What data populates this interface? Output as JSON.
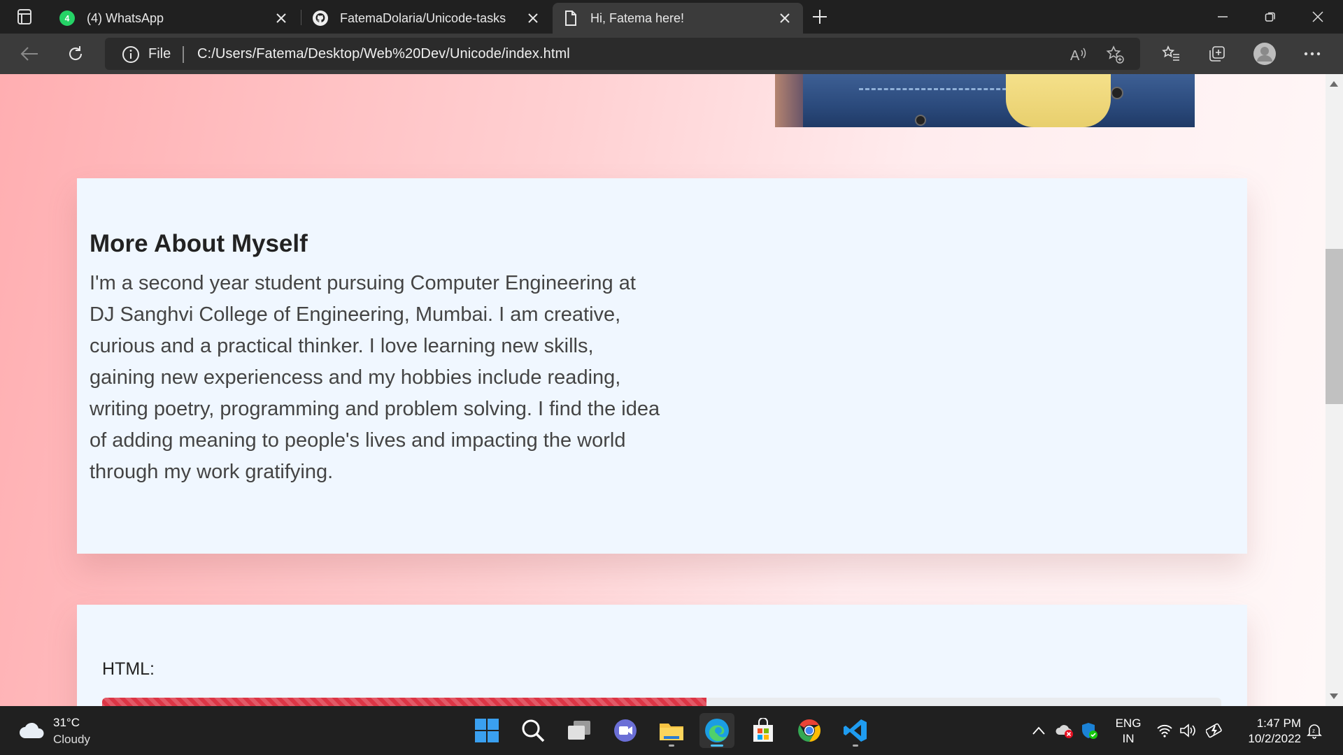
{
  "browser": {
    "tabs": [
      {
        "title": "(4) WhatsApp",
        "badge": "4",
        "icon": "whatsapp-icon"
      },
      {
        "title": "FatemaDolaria/Unicode-tasks",
        "icon": "github-icon"
      },
      {
        "title": "Hi, Fatema here!",
        "icon": "page-icon",
        "active": true
      }
    ],
    "address": {
      "scheme_label": "File",
      "url": "C:/Users/Fatema/Desktop/Web%20Dev/Unicode/index.html"
    }
  },
  "page": {
    "about": {
      "title": "More About Myself",
      "paragraph": "I'm a second year student pursuing Computer Engineering at DJ Sanghvi College of Engineering, Mumbai. I am creative, curious and a practical thinker. I love learning new skills, gaining new experiencess and my hobbies include reading, writing poetry, programming and problem solving. I find the idea of adding meaning to people's lives and impacting the world through my work gratifying."
    },
    "skills": [
      {
        "label": "HTML:",
        "percent": 54,
        "color": "#dc3545"
      }
    ]
  },
  "taskbar": {
    "weather": {
      "temp": "31°C",
      "condition": "Cloudy"
    },
    "apps": [
      "start-icon",
      "search-icon",
      "task-view-icon",
      "chat-icon",
      "file-explorer-icon",
      "edge-icon",
      "store-icon",
      "chrome-icon",
      "vscode-icon"
    ],
    "language": {
      "line1": "ENG",
      "line2": "IN"
    },
    "clock": {
      "time": "1:47 PM",
      "date": "10/2/2022"
    }
  },
  "colors": {
    "accent": "#4cc2ff",
    "page_gradient_start": "#ffaeb1",
    "card_bg": "#f0f7ff",
    "progress": "#dc3545"
  }
}
